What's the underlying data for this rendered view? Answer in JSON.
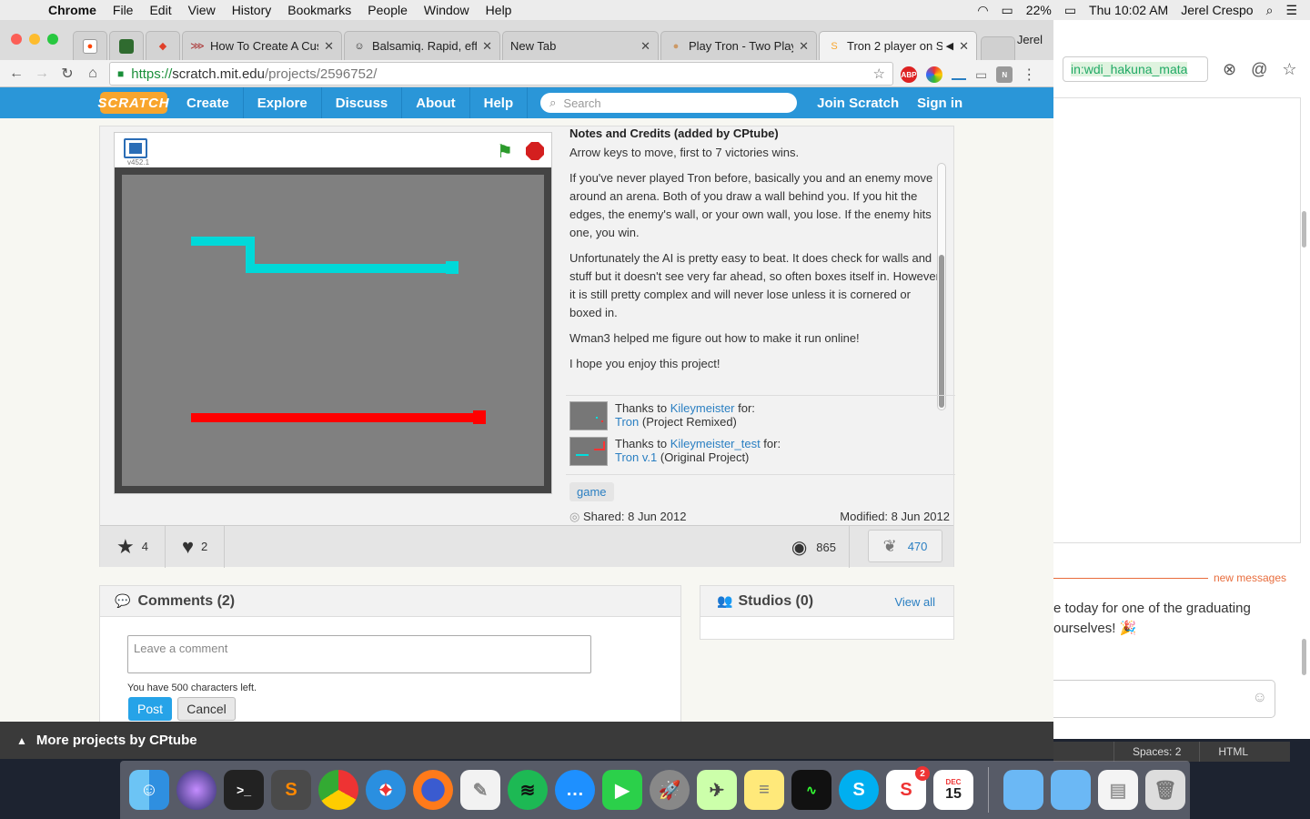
{
  "menubar": {
    "app": "Chrome",
    "items": [
      "File",
      "Edit",
      "View",
      "History",
      "Bookmarks",
      "People",
      "Window",
      "Help"
    ],
    "battery": "22%",
    "clock": "Thu 10:02 AM",
    "user": "Jerel Crespo"
  },
  "browser": {
    "profile": "Jerel",
    "tabs": [
      {
        "label": "How To Create A Cus",
        "icon": "speakerdeck-icon"
      },
      {
        "label": "Balsamiq. Rapid, effe",
        "icon": "balsamiq-icon"
      },
      {
        "label": "New Tab",
        "icon": "none"
      },
      {
        "label": "Play Tron - Two Playe",
        "icon": "cookie-icon"
      },
      {
        "label": "Tron 2 player on S",
        "icon": "scratch-icon"
      }
    ],
    "url_scheme": "https://",
    "url_host": "scratch.mit.edu",
    "url_path": "/projects/2596752/",
    "abp_label": "ABP"
  },
  "scratch_nav": {
    "logo": "SCRATCH",
    "links": [
      "Create",
      "Explore",
      "Discuss",
      "About",
      "Help"
    ],
    "search_placeholder": "Search",
    "join": "Join Scratch",
    "signin": "Sign in"
  },
  "player": {
    "version": "v452.1",
    "stage_colors": {
      "background": "#808080",
      "player1": "#00d9d9",
      "player2": "#ff0000"
    }
  },
  "notes": {
    "title": "Notes and Credits (added by CPtube)",
    "paragraphs": [
      "Arrow keys to move, first to 7 victories wins.",
      "If you've never played Tron before, basically you and an enemy move around an arena. Both of you draw a wall behind you. If you hit the edges, the enemy's wall, or your own wall, you lose. If the enemy hits one, you win.",
      "Unfortunately the AI is pretty easy to beat. It does check for walls and stuff but it doesn't see very far ahead, so often boxes itself in. However it is still pretty complex and will never lose unless it is cornered or boxed in.",
      "Wman3 helped me figure out how to make it run online!",
      "I hope you enjoy this project!"
    ]
  },
  "remix": [
    {
      "prefix": "Thanks to ",
      "user": "Kileymeister",
      "mid": " for:",
      "project": "Tron",
      "suffix": " (Project Remixed)"
    },
    {
      "prefix": "Thanks to ",
      "user": "Kileymeister_test",
      "mid": " for:",
      "project": "Tron v.1",
      "suffix": " (Original Project)"
    }
  ],
  "tag": "game",
  "shared": "Shared: 8 Jun 2012",
  "modified": "Modified: 8 Jun 2012",
  "stats": {
    "favorites": "4",
    "loves": "2",
    "views": "865",
    "remixes": "470"
  },
  "comments": {
    "title": "Comments (2)",
    "placeholder": "Leave a comment",
    "chars_left": "You have 500 characters left.",
    "post": "Post",
    "cancel": "Cancel"
  },
  "studios": {
    "title": "Studios (0)",
    "view_all": "View all"
  },
  "more_projects": "More projects by CPtube",
  "bg_window": {
    "search_text": "in:wdi_hakuna_mata",
    "new_messages": "new messages",
    "message_line1": "e today for one of the graduating",
    "message_line2": "ourselves! 🎉",
    "status_spaces": "Spaces: 2",
    "status_mode": "HTML"
  },
  "dock": {
    "calendar_month": "DEC",
    "calendar_day": "15",
    "sublime_badge": "2"
  }
}
